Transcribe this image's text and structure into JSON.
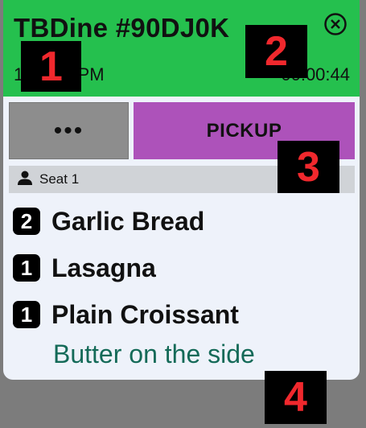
{
  "ticket": {
    "title": "TBDine #90DJ0K",
    "time_left": "1:58:56 PM",
    "time_right": "00:00:44",
    "close_icon": "close-circle-icon"
  },
  "actions": {
    "more_label": "•••",
    "pickup_label": "PICKUP"
  },
  "seat": {
    "icon": "person-icon",
    "label": "Seat 1"
  },
  "items": [
    {
      "qty": "2",
      "name": "Garlic Bread"
    },
    {
      "qty": "1",
      "name": "Lasagna"
    },
    {
      "qty": "1",
      "name": "Plain Croissant",
      "modifier": "Butter on the side"
    }
  ],
  "annotations": [
    "1",
    "2",
    "3",
    "4"
  ],
  "colors": {
    "header": "#25c04e",
    "pickup": "#ad52ba",
    "more": "#8d8d8d",
    "modifier_text": "#146a58",
    "annotation_text": "#f0282d"
  }
}
